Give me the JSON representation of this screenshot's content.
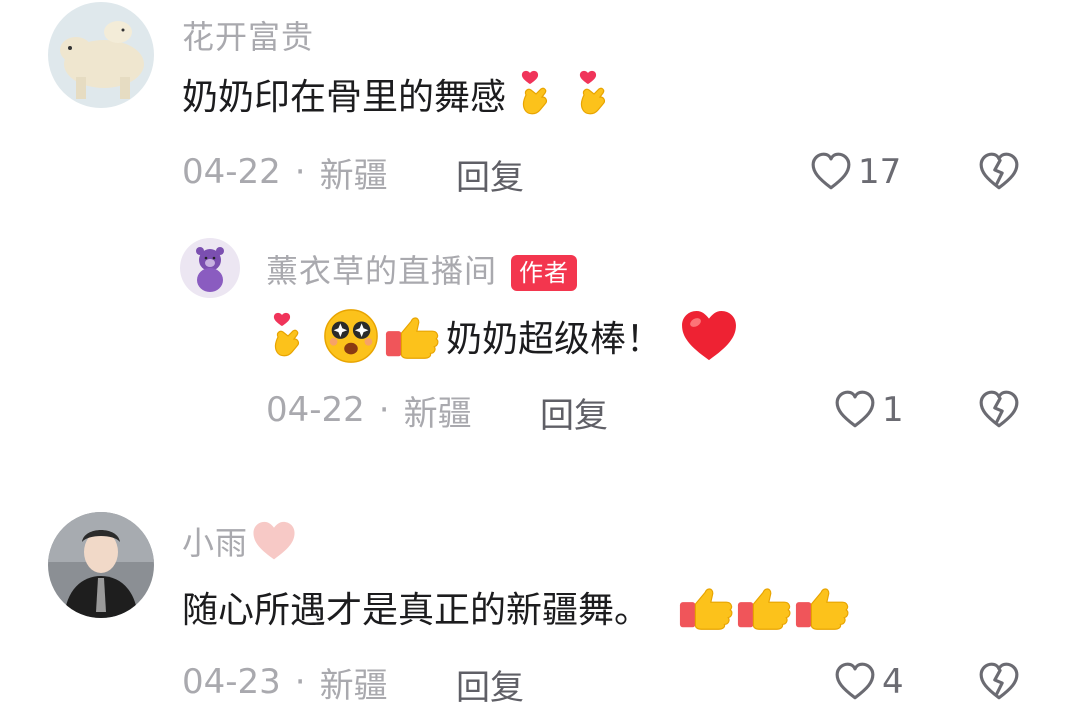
{
  "comments": [
    {
      "username": "花开富贵",
      "text": "奶奶印在骨里的舞感",
      "date": "04-22",
      "location": "新疆",
      "reply_label": "回复",
      "like_count": "17"
    },
    {
      "username": "薰衣草的直播间",
      "badge": "作者",
      "text": "奶奶超级棒！",
      "date": "04-22",
      "location": "新疆",
      "reply_label": "回复",
      "like_count": "1"
    },
    {
      "username": "小雨",
      "text": "随心所遇才是真正的新疆舞。",
      "date": "04-23",
      "location": "新疆",
      "reply_label": "回复",
      "like_count": "4"
    }
  ],
  "separator": "·",
  "icons": {
    "like": "heart-outline-icon",
    "dislike": "broken-heart-icon",
    "finger_heart": "finger-heart-emoji",
    "thumbs_up": "thumbs-up-emoji",
    "starry_eyes": "starry-eyes-emoji",
    "red_heart": "red-heart-emoji",
    "pink_heart": "pink-heart-emoji"
  },
  "colors": {
    "username": "#a9a9ae",
    "text": "#1c1c1e",
    "badge_bg": "#f3364e",
    "meta": "#a9a9ae"
  }
}
